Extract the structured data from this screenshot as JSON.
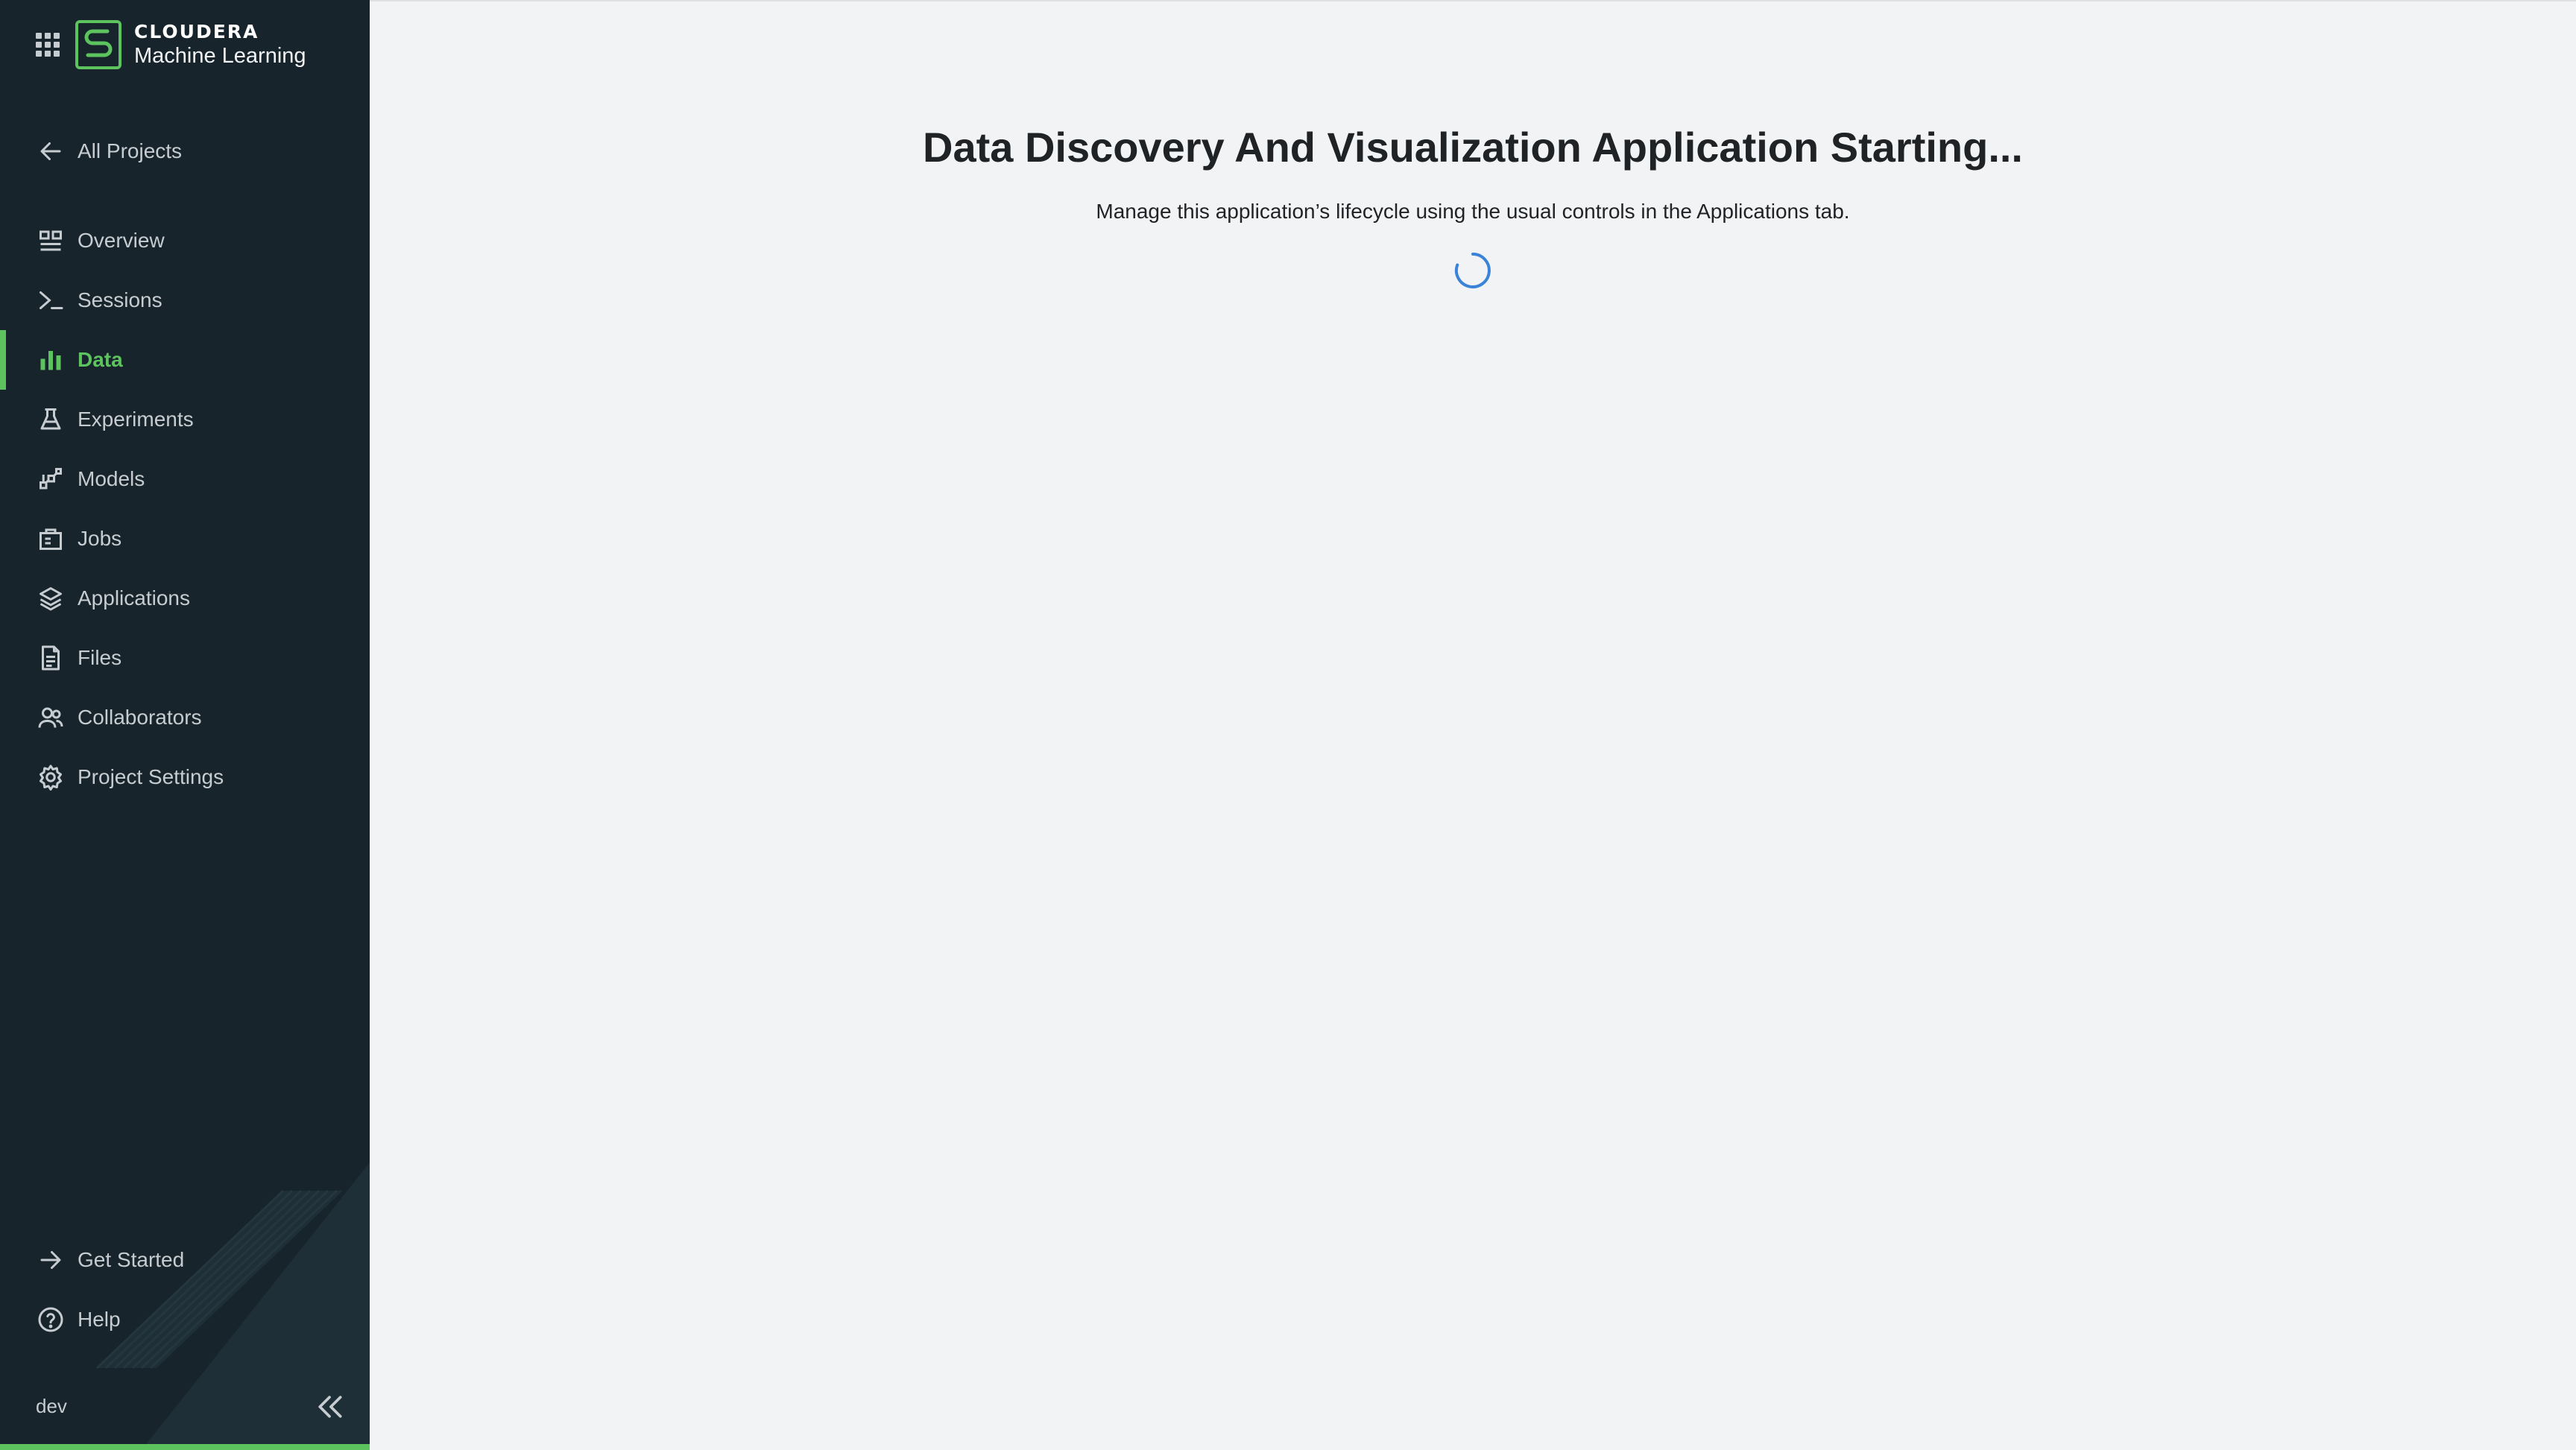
{
  "brand": {
    "company": "CLOUDERA",
    "product": "Machine Learning",
    "accent_color": "#5cc35e"
  },
  "sidebar": {
    "back_link": {
      "label": "All Projects",
      "icon": "arrow-left-icon"
    },
    "items": [
      {
        "label": "Overview",
        "icon": "overview-icon",
        "active": false
      },
      {
        "label": "Sessions",
        "icon": "terminal-icon",
        "active": false
      },
      {
        "label": "Data",
        "icon": "bar-chart-icon",
        "active": true
      },
      {
        "label": "Experiments",
        "icon": "flask-icon",
        "active": false
      },
      {
        "label": "Models",
        "icon": "model-icon",
        "active": false
      },
      {
        "label": "Jobs",
        "icon": "jobs-icon",
        "active": false
      },
      {
        "label": "Applications",
        "icon": "layers-icon",
        "active": false
      },
      {
        "label": "Files",
        "icon": "file-icon",
        "active": false
      },
      {
        "label": "Collaborators",
        "icon": "users-icon",
        "active": false
      },
      {
        "label": "Project Settings",
        "icon": "gear-icon",
        "active": false
      }
    ],
    "footer_items": [
      {
        "label": "Get Started",
        "icon": "arrow-right-icon"
      },
      {
        "label": "Help",
        "icon": "help-icon"
      }
    ],
    "environment": "dev"
  },
  "main": {
    "title": "Data Discovery And Visualization Application Starting...",
    "subtitle": "Manage this application’s lifecycle using the usual controls in the Applications tab.",
    "spinner_color": "#3a83d9"
  }
}
